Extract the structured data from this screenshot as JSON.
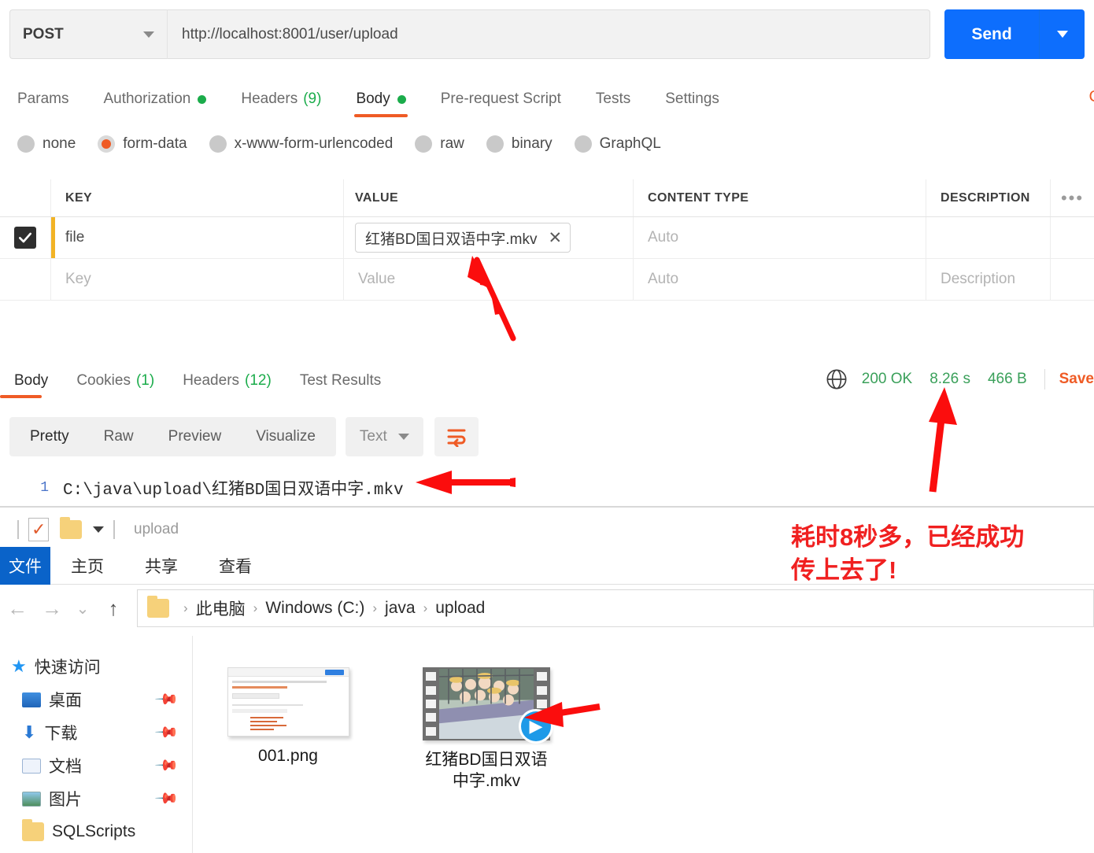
{
  "request": {
    "method": "POST",
    "url": "http://localhost:8001/user/upload",
    "send_label": "Send",
    "tabs": [
      {
        "label": "Params",
        "dot": false,
        "count": null
      },
      {
        "label": "Authorization",
        "dot": true,
        "count": null
      },
      {
        "label": "Headers",
        "dot": false,
        "count": "(9)"
      },
      {
        "label": "Body",
        "dot": true,
        "count": null
      },
      {
        "label": "Pre-request Script",
        "dot": false,
        "count": null
      },
      {
        "label": "Tests",
        "dot": false,
        "count": null
      },
      {
        "label": "Settings",
        "dot": false,
        "count": null
      }
    ],
    "active_tab": "Body",
    "cookies_edge_label": "C",
    "body_types": [
      "none",
      "form-data",
      "x-www-form-urlencoded",
      "raw",
      "binary",
      "GraphQL"
    ],
    "body_type_selected": "form-data"
  },
  "form_table": {
    "headers": [
      "KEY",
      "VALUE",
      "CONTENT TYPE",
      "DESCRIPTION"
    ],
    "more_icon": "•••",
    "rows": [
      {
        "checked": true,
        "key": "file",
        "value": "红猪BD国日双语中字.mkv",
        "value_is_file": true,
        "remove_label": "✕",
        "content_type": "Auto",
        "description": ""
      }
    ],
    "placeholder_row": {
      "key": "Key",
      "value": "Value",
      "content_type": "Auto",
      "description": "Description"
    }
  },
  "response": {
    "tabs": [
      {
        "label": "Body",
        "count": null
      },
      {
        "label": "Cookies",
        "count": "(1)"
      },
      {
        "label": "Headers",
        "count": "(12)"
      },
      {
        "label": "Test Results",
        "count": null
      }
    ],
    "active_tab": "Body",
    "status": "200 OK",
    "time": "8.26 s",
    "size": "466 B",
    "save_label": "Save",
    "view_modes": [
      "Pretty",
      "Raw",
      "Preview",
      "Visualize"
    ],
    "view_mode_selected": "Pretty",
    "format": "Text",
    "line_number": "1",
    "body_line": "C:\\java\\upload\\红猪BD国日双语中字.mkv"
  },
  "explorer": {
    "quick_bar_label": "upload",
    "ribbon": {
      "file_label": "文件",
      "tabs": [
        "主页",
        "共享",
        "查看"
      ]
    },
    "address": {
      "crumbs": [
        "此电脑",
        "Windows (C:)",
        "java",
        "upload"
      ],
      "separator": "›"
    },
    "sidebar": [
      {
        "label": "快速访问",
        "icon": "star-icon",
        "pinned": false,
        "child": false
      },
      {
        "label": "桌面",
        "icon": "desktop-icon",
        "pinned": true,
        "child": true
      },
      {
        "label": "下载",
        "icon": "download-icon",
        "pinned": true,
        "child": true
      },
      {
        "label": "文档",
        "icon": "document-icon",
        "pinned": true,
        "child": true
      },
      {
        "label": "图片",
        "icon": "pictures-icon",
        "pinned": true,
        "child": true
      },
      {
        "label": "SQLScripts",
        "icon": "folder-icon",
        "pinned": false,
        "child": true
      }
    ],
    "files": [
      {
        "name": "001.png",
        "type": "image"
      },
      {
        "name": "红猪BD国日双语中字.mkv",
        "type": "video"
      }
    ]
  },
  "annotations": {
    "note": "耗时8秒多，已经成功\n传上去了!",
    "note_color": "#f02020",
    "arrow_color": "#fb0d0d"
  }
}
